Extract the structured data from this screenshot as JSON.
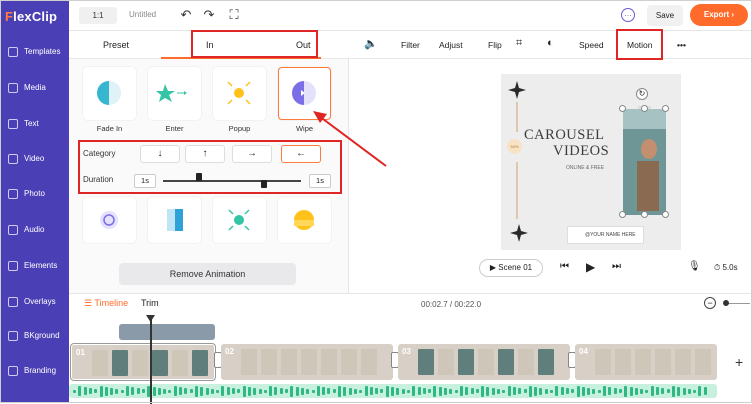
{
  "app": {
    "logo_lead": "F",
    "logo_rest": "lexClip"
  },
  "sidebar": {
    "items": [
      {
        "label": "Templates",
        "icon": "templates-icon"
      },
      {
        "label": "Media",
        "icon": "media-icon"
      },
      {
        "label": "Text",
        "icon": "text-icon"
      },
      {
        "label": "Video",
        "icon": "video-icon"
      },
      {
        "label": "Photo",
        "icon": "photo-icon"
      },
      {
        "label": "Audio",
        "icon": "audio-icon"
      },
      {
        "label": "Elements",
        "icon": "elements-icon"
      },
      {
        "label": "Overlays",
        "icon": "overlays-icon"
      },
      {
        "label": "BKground",
        "icon": "background-icon"
      },
      {
        "label": "Branding",
        "icon": "branding-icon"
      }
    ]
  },
  "topbar": {
    "ratio": "1:1",
    "title": "Untitled",
    "save": "Save",
    "export": "Export ›"
  },
  "panel": {
    "tabs": [
      "Preset",
      "In",
      "Out"
    ],
    "effects": [
      "Fade In",
      "Enter",
      "Popup",
      "Wipe"
    ],
    "selected_effect": "Wipe",
    "category_label": "Category",
    "category_options": [
      "↓",
      "↑",
      "→",
      "←"
    ],
    "duration_label": "Duration",
    "duration_min": "1s",
    "duration_max": "1s",
    "remove_label": "Remove Animation"
  },
  "toolbar": {
    "items": [
      "Filter",
      "Adjust",
      "Flip",
      "Speed",
      "Motion"
    ]
  },
  "canvas": {
    "title_line1": "CAROUSEL",
    "title_line2": "VIDEOS",
    "subtitle": "ONLINE & FREE",
    "badge": "50%",
    "ig_text": "@YOUR NAME HERE"
  },
  "player": {
    "scene": "Scene 01",
    "speed": "5.0s"
  },
  "timeline": {
    "tab_timeline": "Timeline",
    "tab_trim": "Trim",
    "time": "00:02.7 / 00:22.0",
    "scenes": [
      "01",
      "02",
      "03",
      "04"
    ]
  },
  "colors": {
    "accent": "#ff6b2b",
    "sidebar": "#4b3fb5",
    "annotation": "#e02525"
  }
}
